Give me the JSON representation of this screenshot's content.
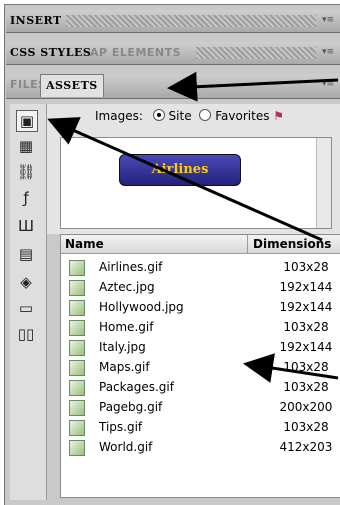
{
  "panel_tabs": {
    "insert": "INSERT",
    "css_styles": "CSS STYLES",
    "ap_elements": "AP ELEMENTS",
    "files": "FILES",
    "assets": "ASSETS"
  },
  "images_label": "Images:",
  "radio_site": "Site",
  "radio_favorites": "Favorites",
  "preview_text": "Airlines",
  "columns": {
    "name": "Name",
    "dimensions": "Dimensions"
  },
  "files": [
    {
      "name": "Airlines.gif",
      "dim": "103x28"
    },
    {
      "name": "Aztec.jpg",
      "dim": "192x144"
    },
    {
      "name": "Hollywood.jpg",
      "dim": "192x144"
    },
    {
      "name": "Home.gif",
      "dim": "103x28"
    },
    {
      "name": "Italy.jpg",
      "dim": "192x144"
    },
    {
      "name": "Maps.gif",
      "dim": "103x28"
    },
    {
      "name": "Packages.gif",
      "dim": "103x28"
    },
    {
      "name": "Pagebg.gif",
      "dim": "200x200"
    },
    {
      "name": "Tips.gif",
      "dim": "103x28"
    },
    {
      "name": "World.gif",
      "dim": "412x203"
    }
  ],
  "side_icons": [
    "image-icon",
    "colors-icon",
    "link-icon",
    "flash-icon",
    "shockwave-icon",
    "movie-icon",
    "script-icon",
    "template-icon",
    "library-icon"
  ]
}
